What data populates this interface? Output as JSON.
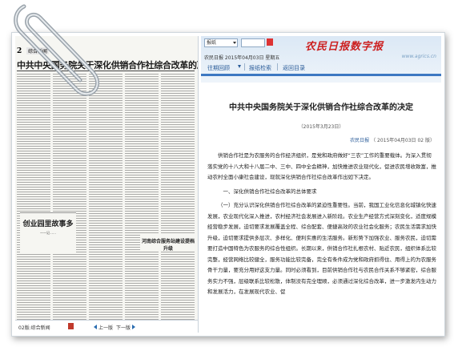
{
  "paper": {
    "page_num": "2",
    "section_label": "综合新闻",
    "headline": "中共中央国务院关于深化供销合作社综合改革的决定",
    "box1_headline": "创业园里故事多",
    "box1_sub": "——记……",
    "box2_headline": "河南综合服务站建设提档升级",
    "footer": {
      "edition": "02版:综合新闻",
      "prev": "上一版",
      "next": "下一版"
    }
  },
  "header": {
    "select_label": "报纸",
    "brand": "农民日报数字报",
    "dateline": "农民日报 2015年04月03日 星期五",
    "url": "www.agrics.cn",
    "nav": [
      "往期回顾",
      "报纸检索",
      "返回目录"
    ]
  },
  "article": {
    "title": "中共中央国务院关于深化供销合作社综合改革的决定",
    "pubdate": "（2015年3月23日）",
    "byline_prefix": "农民日报",
    "byline_date": "（ 2015年04月03日 02 版）",
    "paragraphs": [
      "供销合作社是为农服务的合作经济组织，是党和政府做好“三农”工作的重要载体。为深入贯彻落实党的十八大和十八届二中、三中、四中全会精神，加快推进农业现代化，促进农民增收致富，推动农村全面小康社会建设，现就深化供销合作社综合改革作出如下决定。"
    ],
    "section_heading": "一、深化供销合作社综合改革的总体要求",
    "body_paragraphs": [
      "（一）充分认识深化供销合作社综合改革的紧迫性重要性。当前，我国工业化信息化城镇化快速发展，农业现代化深入推进，农村经济社会发展进入新阶段。农业生产经营方式深刻变化，适度规模经营稳步发展，迫切要求发展覆盖全程、综合配套、便捷高效的农业社会化服务；农民生活需求加快升级，迫切要求提供多层次、多样化、便利实惠的生活服务。新形势下加强农业、服务农民，迫切需要打造中国特色为农服务的综合性组织。长期以来，供销合作社扎根农村、贴近农民，组织体系比较完整，经营网络比较健全，服务功能比较完备，完全有条件成为党和政府抓得住、用得上的为农服务骨干力量，要充分用好这支力量。同时必须看到，目前供销合作社与农民合作关系不够紧密，综合服务实力不强，层级联系比较松散，体制没有完全理顺，必须通过深化综合改革，进一步激发内生动力和发展活力，在发展现代农业、促"
    ]
  },
  "colors": {
    "brand_red": "#cc1f1f",
    "nav_blue": "#2a5c99",
    "bar_blue": "#3d78c2"
  },
  "icons": {
    "clip": "paperclip-icon",
    "pdf": "pdf-icon",
    "prev": "arrow-left-icon",
    "next": "arrow-right-icon"
  }
}
